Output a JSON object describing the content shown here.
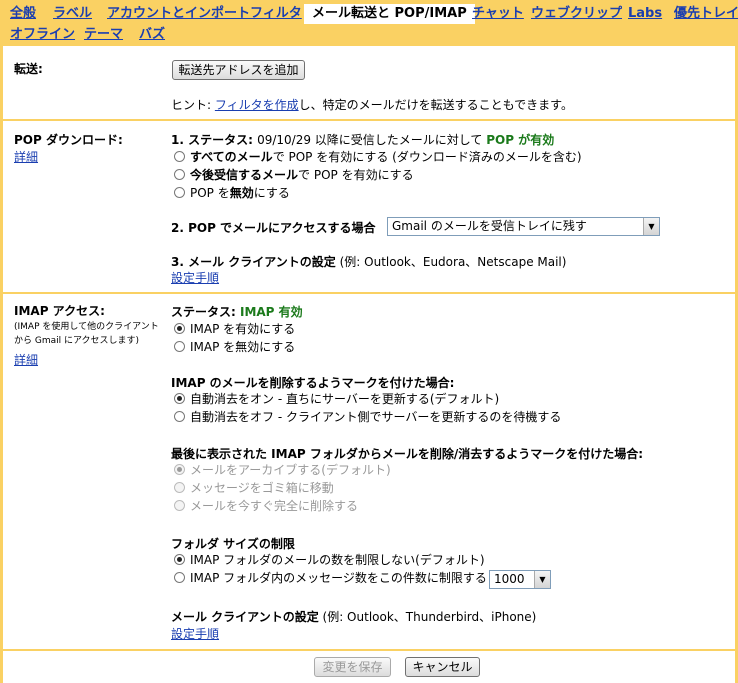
{
  "tabs": {
    "row1": [
      "全般",
      "ラベル",
      "アカウントとインポート",
      "フィルタ",
      "メール転送と POP/IMAP",
      "チャット",
      "ウェブクリップ",
      "Labs",
      "優先トレイ"
    ],
    "row2": [
      "オフライン",
      "テーマ",
      "バズ"
    ]
  },
  "forwarding": {
    "label": "転送:",
    "add_button": "転送先アドレスを追加",
    "hint_prefix": "ヒント: ",
    "hint_link": "フィルタを作成",
    "hint_suffix": "し、特定のメールだけを転送することもできます。"
  },
  "pop": {
    "label": "POP ダウンロード:",
    "details": "詳細",
    "status_prefix": "1. ステータス: ",
    "status_text": "09/10/29 以降に受信したメールに対して ",
    "status_value": "POP が有効",
    "options": [
      {
        "bold": "すべてのメール",
        "text": "で POP を有効にする (ダウンロード済みのメールを含む)"
      },
      {
        "bold": "今後受信するメール",
        "text": "で POP を有効にする"
      },
      {
        "bold": "",
        "text": "POP を",
        "bold2": "無効",
        "text2": "にする"
      }
    ],
    "access_label": "2. POP でメールにアクセスする場合",
    "access_value": "Gmail のメールを受信トレイに残す",
    "client_label": "3. メール クライアントの設定",
    "client_examples": " (例: Outlook、Eudora、Netscape Mail)",
    "setup_link": "設定手順"
  },
  "imap": {
    "label": "IMAP アクセス:",
    "note": "(IMAP を使用して他のクライアントから Gmail にアクセスします)",
    "details": "詳細",
    "status_label": "ステータス: ",
    "status_value": "IMAP 有効",
    "enable_options": [
      "IMAP を有効にする",
      "IMAP を無効にする"
    ],
    "delete_heading": "IMAP のメールを削除するようマークを付けた場合:",
    "delete_options": [
      "自動消去をオン - 直ちにサーバーを更新する(デフォルト)",
      "自動消去をオフ - クライアント側でサーバーを更新するのを待機する"
    ],
    "expunge_heading": "最後に表示された IMAP フォルダからメールを削除/消去するようマークを付けた場合:",
    "expunge_options": [
      "メールをアーカイブする(デフォルト)",
      "メッセージをゴミ箱に移動",
      "メールを今すぐ完全に削除する"
    ],
    "folder_heading": "フォルダ サイズの制限",
    "folder_options": [
      "IMAP フォルダのメールの数を制限しない(デフォルト)",
      "IMAP フォルダ内のメッセージ数をこの件数に制限する"
    ],
    "folder_limit_value": "1000",
    "client_label": "メール クライアントの設定",
    "client_examples": " (例: Outlook、Thunderbird、iPhone)",
    "setup_link": "設定手順"
  },
  "footer": {
    "save": "変更を保存",
    "cancel": "キャンセル"
  },
  "colors": {
    "accent": "#fad163",
    "link": "#1a3eb0",
    "status_green": "#1b7a1b"
  }
}
